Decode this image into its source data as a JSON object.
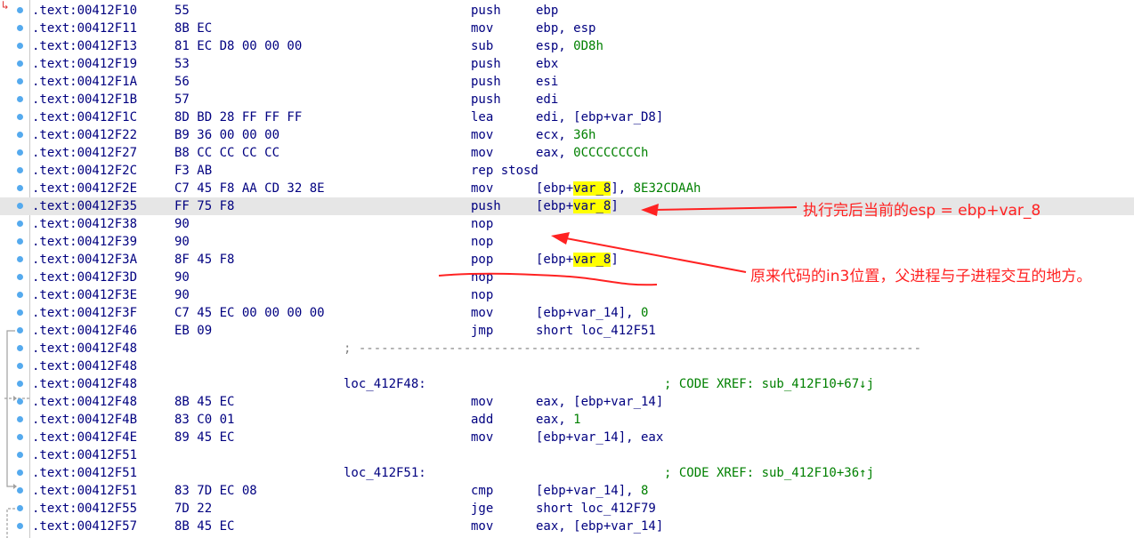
{
  "rows": [
    {
      "addr": ".text:00412F10",
      "bytes": "55",
      "mnem": "push",
      "ops": [
        {
          "t": "ebp"
        }
      ]
    },
    {
      "addr": ".text:00412F11",
      "bytes": "8B EC",
      "mnem": "mov",
      "ops": [
        {
          "t": "ebp, esp"
        }
      ]
    },
    {
      "addr": ".text:00412F13",
      "bytes": "81 EC D8 00 00 00",
      "mnem": "sub",
      "ops": [
        {
          "t": "esp, "
        },
        {
          "t": "0D8h",
          "num": true
        }
      ]
    },
    {
      "addr": ".text:00412F19",
      "bytes": "53",
      "mnem": "push",
      "ops": [
        {
          "t": "ebx"
        }
      ]
    },
    {
      "addr": ".text:00412F1A",
      "bytes": "56",
      "mnem": "push",
      "ops": [
        {
          "t": "esi"
        }
      ]
    },
    {
      "addr": ".text:00412F1B",
      "bytes": "57",
      "mnem": "push",
      "ops": [
        {
          "t": "edi"
        }
      ]
    },
    {
      "addr": ".text:00412F1C",
      "bytes": "8D BD 28 FF FF FF",
      "mnem": "lea",
      "ops": [
        {
          "t": "edi, [ebp+var_D8]"
        }
      ]
    },
    {
      "addr": ".text:00412F22",
      "bytes": "B9 36 00 00 00",
      "mnem": "mov",
      "ops": [
        {
          "t": "ecx, "
        },
        {
          "t": "36h",
          "num": true
        }
      ]
    },
    {
      "addr": ".text:00412F27",
      "bytes": "B8 CC CC CC CC",
      "mnem": "mov",
      "ops": [
        {
          "t": "eax, "
        },
        {
          "t": "0CCCCCCCCh",
          "num": true
        }
      ]
    },
    {
      "addr": ".text:00412F2C",
      "bytes": "F3 AB",
      "mnem": "rep stosd",
      "ops": []
    },
    {
      "addr": ".text:00412F2E",
      "bytes": "C7 45 F8 AA CD 32 8E",
      "mnem": "mov",
      "ops": [
        {
          "t": "[ebp+"
        },
        {
          "t": "var_8",
          "hl": true
        },
        {
          "t": "], "
        },
        {
          "t": "8E32CDAAh",
          "num": true
        }
      ]
    },
    {
      "addr": ".text:00412F35",
      "bytes": "FF 75 F8",
      "mnem": "push",
      "ops": [
        {
          "t": "[ebp+"
        },
        {
          "t": "var_8",
          "hl": true
        },
        {
          "t": "]"
        }
      ],
      "selected": true
    },
    {
      "addr": ".text:00412F38",
      "bytes": "90",
      "mnem": "nop",
      "ops": []
    },
    {
      "addr": ".text:00412F39",
      "bytes": "90",
      "mnem": "nop",
      "ops": []
    },
    {
      "addr": ".text:00412F3A",
      "bytes": "8F 45 F8",
      "mnem": "pop",
      "ops": [
        {
          "t": "[ebp+"
        },
        {
          "t": "var_8",
          "hl": true
        },
        {
          "t": "]"
        }
      ]
    },
    {
      "addr": ".text:00412F3D",
      "bytes": "90",
      "mnem": "nop",
      "ops": []
    },
    {
      "addr": ".text:00412F3E",
      "bytes": "90",
      "mnem": "nop",
      "ops": []
    },
    {
      "addr": ".text:00412F3F",
      "bytes": "C7 45 EC 00 00 00 00",
      "mnem": "mov",
      "ops": [
        {
          "t": "[ebp+var_14], "
        },
        {
          "t": "0",
          "num": true
        }
      ]
    },
    {
      "addr": ".text:00412F46",
      "bytes": "EB 09",
      "mnem": "jmp",
      "ops": [
        {
          "t": "short loc_412F51"
        }
      ]
    },
    {
      "addr": ".text:00412F48",
      "sep": "; ---------------------------------------------------------------------------"
    },
    {
      "addr": ".text:00412F48"
    },
    {
      "addr": ".text:00412F48",
      "label": "loc_412F48:",
      "comment": "; CODE XREF: sub_412F10+67↓j"
    },
    {
      "addr": ".text:00412F48",
      "bytes": "8B 45 EC",
      "mnem": "mov",
      "ops": [
        {
          "t": "eax, [ebp+var_14]"
        }
      ]
    },
    {
      "addr": ".text:00412F4B",
      "bytes": "83 C0 01",
      "mnem": "add",
      "ops": [
        {
          "t": "eax, "
        },
        {
          "t": "1",
          "num": true
        }
      ]
    },
    {
      "addr": ".text:00412F4E",
      "bytes": "89 45 EC",
      "mnem": "mov",
      "ops": [
        {
          "t": "[ebp+var_14], eax"
        }
      ]
    },
    {
      "addr": ".text:00412F51"
    },
    {
      "addr": ".text:00412F51",
      "label": "loc_412F51:",
      "comment": "; CODE XREF: sub_412F10+36↑j"
    },
    {
      "addr": ".text:00412F51",
      "bytes": "83 7D EC 08",
      "mnem": "cmp",
      "ops": [
        {
          "t": "[ebp+var_14], "
        },
        {
          "t": "8",
          "num": true
        }
      ]
    },
    {
      "addr": ".text:00412F55",
      "bytes": "7D 22",
      "mnem": "jge",
      "ops": [
        {
          "t": "short loc_412F79"
        }
      ]
    },
    {
      "addr": ".text:00412F57",
      "bytes": "8B 45 EC",
      "mnem": "mov",
      "ops": [
        {
          "t": "eax, [ebp+var_14]"
        }
      ]
    }
  ],
  "annotations": {
    "note_esp": "执行完后当前的esp = ebp+var_8",
    "note_int3": "原来代码的in3位置，父进程与子进程交互的地方。"
  },
  "colors": {
    "text": "#000080",
    "number": "#008000",
    "highlight": "#ffff00",
    "selection": "#e6e6e6",
    "annotation": "#ff2222",
    "breakpoint_dot": "#55aaee"
  }
}
